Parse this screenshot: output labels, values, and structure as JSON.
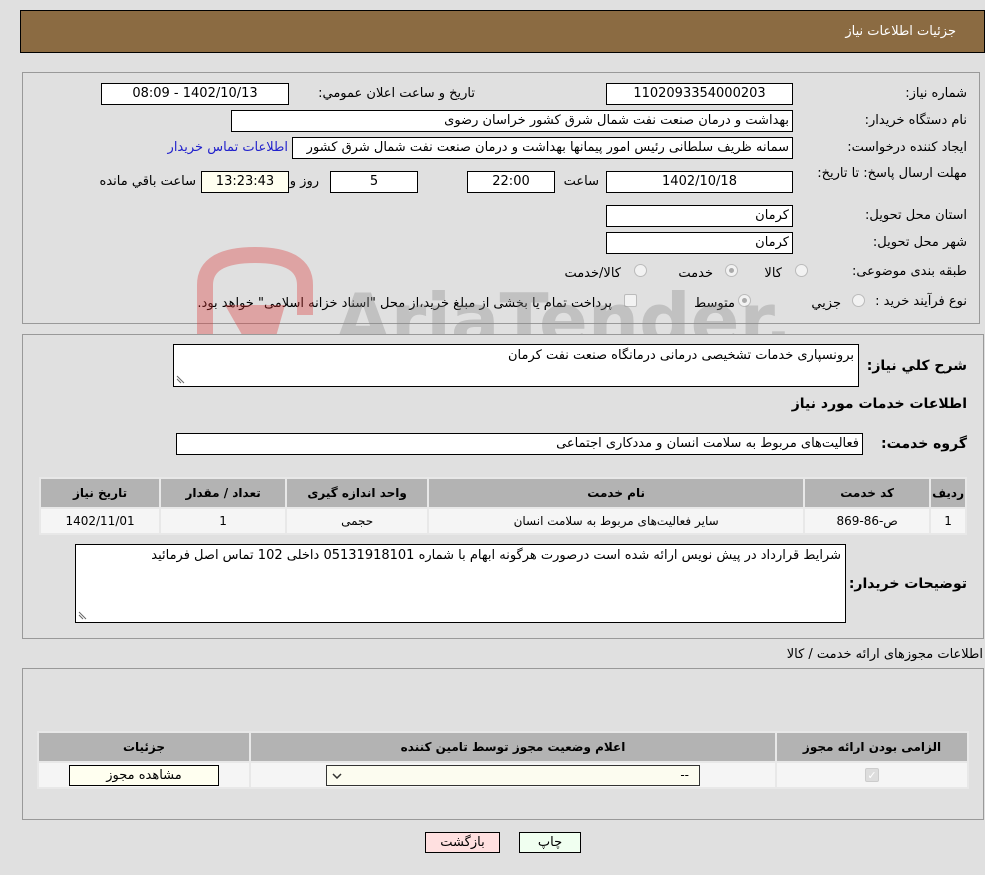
{
  "header": {
    "title": "جزئیات اطلاعات نیاز"
  },
  "form": {
    "need_number": {
      "label": "شماره نیاز:",
      "value": "1102093354000203"
    },
    "announce_datetime": {
      "label": "تاریخ و ساعت اعلان عمومي:",
      "value": "1402/10/13 - 08:09"
    },
    "buyer_org": {
      "label": "نام دستگاه خريدار:",
      "value": "بهداشت و درمان صنعت نفت شمال شرق کشور   خراسان رضوی"
    },
    "requester": {
      "label": "ایجاد کننده درخواست:",
      "value": "سمانه ظریف سلطانی رئیس امور پیمانها بهداشت و درمان صنعت نفت شمال شرق کشور"
    },
    "contact_link": "اطلاعات تماس خریدار",
    "deadline": {
      "label": "مهلت ارسال پاسخ: تا تاریخ:",
      "date": "1402/10/18",
      "time_label": "ساعت",
      "time": "22:00",
      "days": "5",
      "days_label": "روز و",
      "remaining": "13:23:43",
      "remaining_label": "ساعت باقي مانده"
    },
    "province": {
      "label": "استان محل تحویل:",
      "value": "کرمان"
    },
    "city": {
      "label": "شهر محل تحویل:",
      "value": "کرمان"
    },
    "category": {
      "label": "طبقه بندی موضوعی:",
      "options": [
        "کالا",
        "خدمت",
        "کالا/خدمت"
      ],
      "selected": "خدمت"
    },
    "purchase_type": {
      "label": "نوع فرآیند خرید :",
      "options": [
        "جزيي",
        "متوسط"
      ],
      "selected": "متوسط",
      "treasury_checkbox_label": "پرداخت تمام یا بخشی از مبلغ خرید،از محل \"اسناد خزانه اسلامی\" خواهد بود."
    }
  },
  "summary": {
    "label": "شرح کلي نياز:",
    "value": "برونسپاری خدمات تشخیصی درمانی درمانگاه صنعت نفت کرمان",
    "services_heading": "اطلاعات خدمات مورد نیاز",
    "service_group_label": "گروه خدمت:",
    "service_group_value": "فعالیت‌های مربوط به سلامت انسان و مددکاری اجتماعی"
  },
  "services_table": {
    "headers": [
      "ردیف",
      "کد خدمت",
      "نام خدمت",
      "واحد اندازه گیری",
      "تعداد / مقدار",
      "تاریخ نیاز"
    ],
    "rows": [
      [
        "1",
        "ص-86-869",
        "سایر فعالیت‌های مربوط به سلامت انسان",
        "حجمی",
        "1",
        "1402/11/01"
      ]
    ]
  },
  "buyer_notes": {
    "label": "توضیحات خریدار:",
    "value": "شرایط قرارداد در پیش نویس ارائه شده است درصورت هرگونه ابهام با شماره 05131918101 داخلی 102 تماس اصل فرمائید"
  },
  "permits": {
    "title": "اطلاعات مجوزهای ارائه خدمت / کالا",
    "headers": [
      "الزامی بودن ارائه مجوز",
      "اعلام وضعیت مجوز توسط تامین کننده",
      "جزئیات"
    ],
    "row": {
      "required_checked": true,
      "status_value": "--",
      "details_button": "مشاهده مجوز"
    }
  },
  "footer": {
    "print_button": "چاپ",
    "back_button": "بازگشت"
  },
  "watermark": {
    "text": "AriaTender.neT"
  }
}
